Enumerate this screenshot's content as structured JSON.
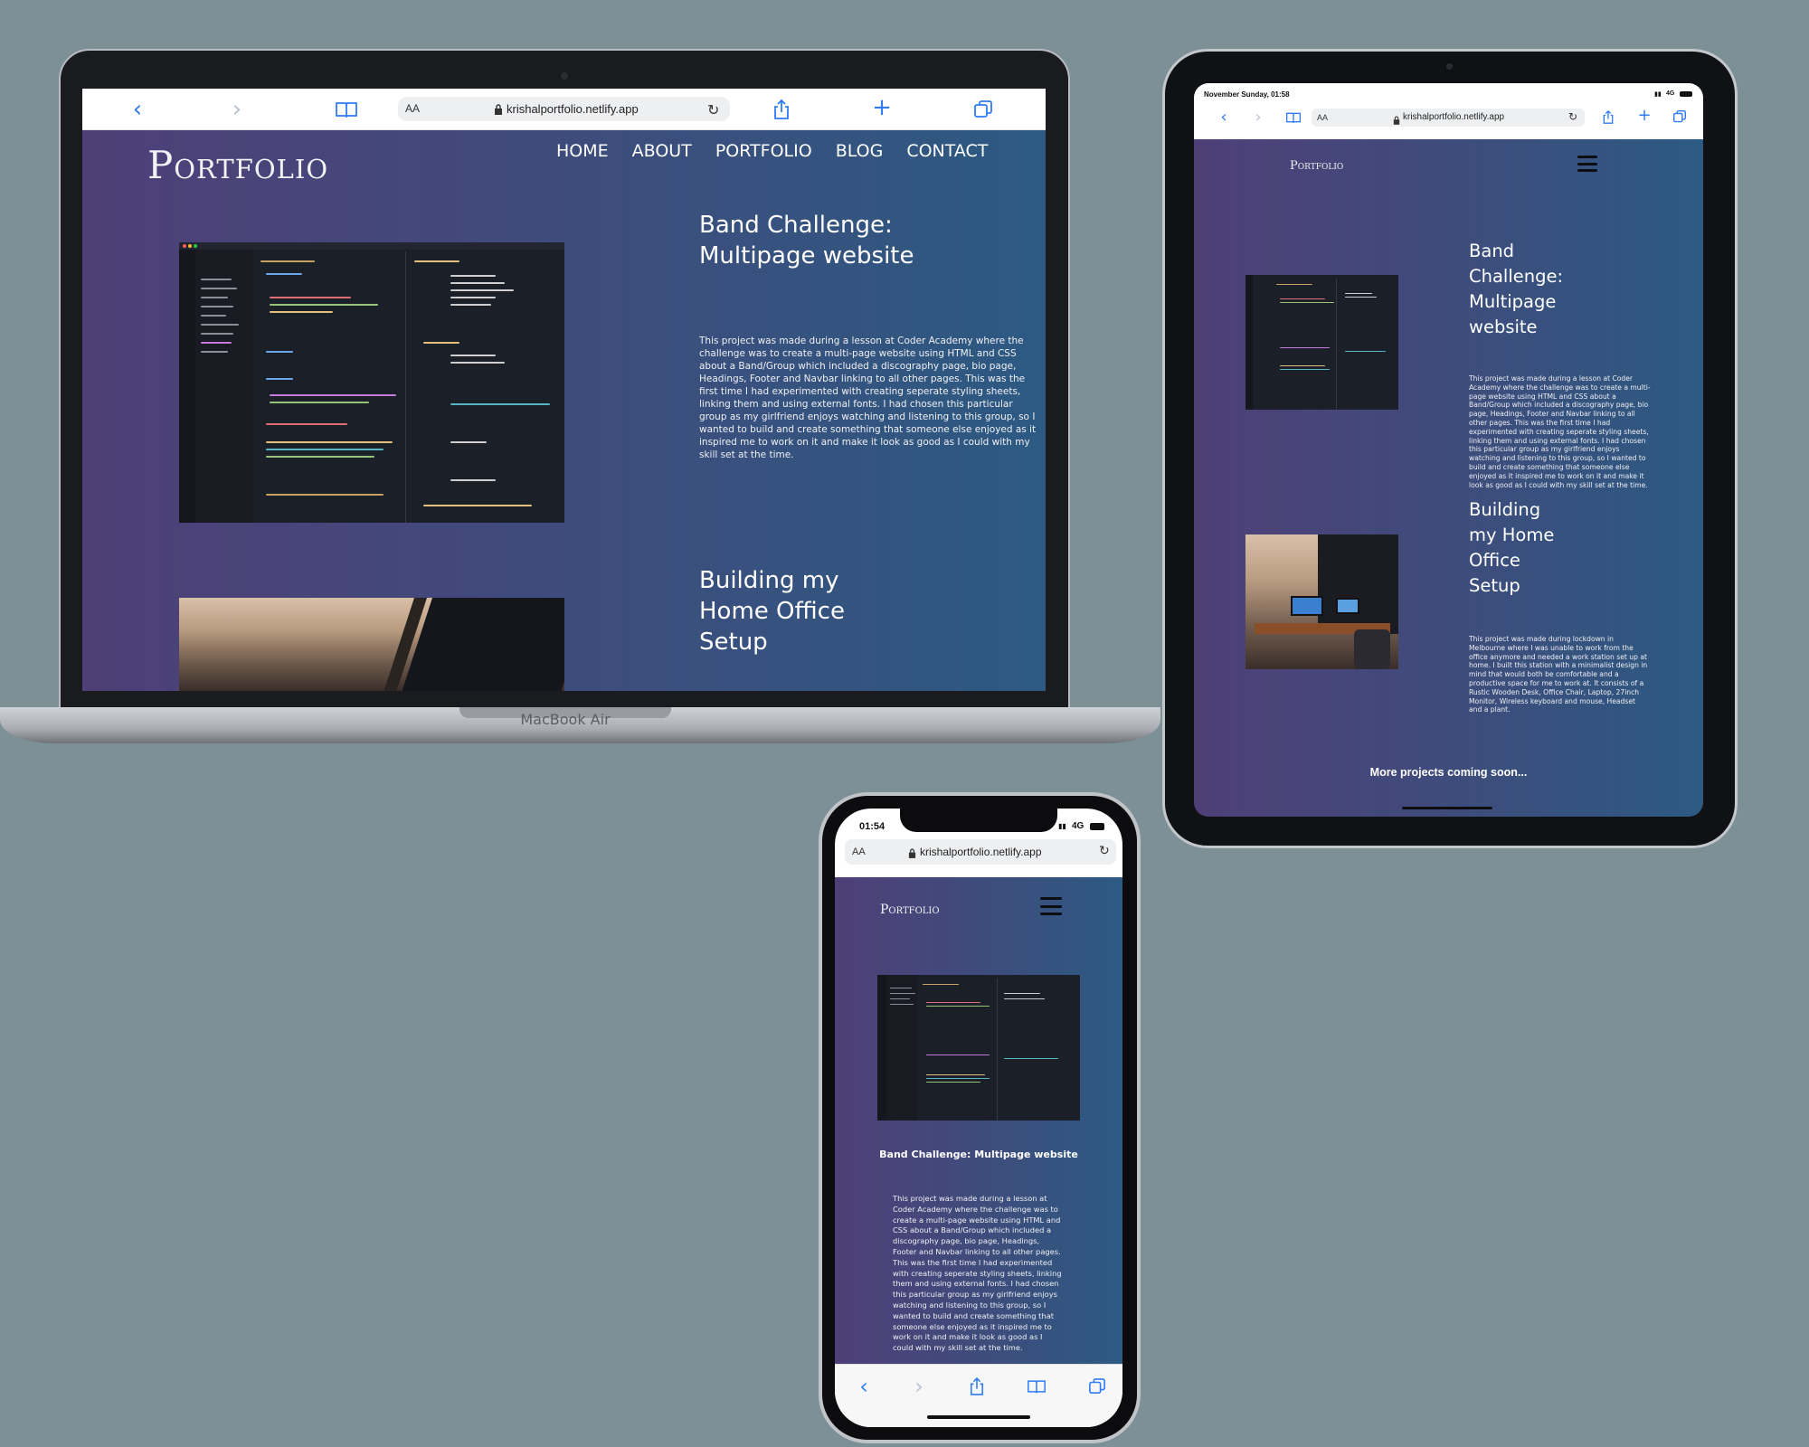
{
  "url": "krishalportfolio.netlify.app",
  "aa_label": "AA",
  "icons": {
    "back": "chevron-left-icon",
    "forward": "chevron-right-icon",
    "bookmarks": "book-icon",
    "share": "share-icon",
    "new_tab": "plus-icon",
    "tabs": "tabs-icon",
    "reload": "reload-icon",
    "lock": "lock-icon",
    "menu": "hamburger-menu-icon"
  },
  "colors": {
    "backdrop": "#7d9096",
    "site_gradient_start": "#4e3f77",
    "site_gradient_end": "#2c5a82",
    "browser_accent": "#2f7cf6"
  },
  "site": {
    "logo": "Portfolio",
    "nav": [
      "HOME",
      "ABOUT",
      "PORTFOLIO",
      "BLOG",
      "CONTACT"
    ],
    "projects": [
      {
        "title": "Band Challenge: Multipage website",
        "description": "This project was made during a lesson at Coder Academy where the challenge was to create a multi-page website using HTML and CSS about a Band/Group which included a discography page, bio page, Headings, Footer and Navbar linking to all other pages. This was the first time I had experimented with creating seperate styling sheets, linking them and using external fonts. I had chosen this particular group as my girlfriend enjoys watching and listening to this group, so I wanted to build and create something that someone else enjoyed as it inspired me to work on it and make it look as good as I could with my skill set at the time."
      },
      {
        "title": "Building my Home Office Setup",
        "description": "This project was made during lockdown in Melbourne where I was unable to work from the office anymore and needed a work station set up at home. I built this station with a minimalist design in mind that would both be comfortable and a productive space for me to work at. It consists of a Rustic Wooden Desk, Office Chair, Laptop, 27inch Monitor, Wireless keyboard and mouse, Headset and a plant."
      }
    ],
    "more_projects": "More projects coming soon..."
  },
  "devices": {
    "laptop_label": "MacBook Air",
    "tablet_status": "November Sunday, 01:58",
    "tablet_signal": "4G",
    "phone_time": "01:54",
    "phone_signal": "4G"
  }
}
